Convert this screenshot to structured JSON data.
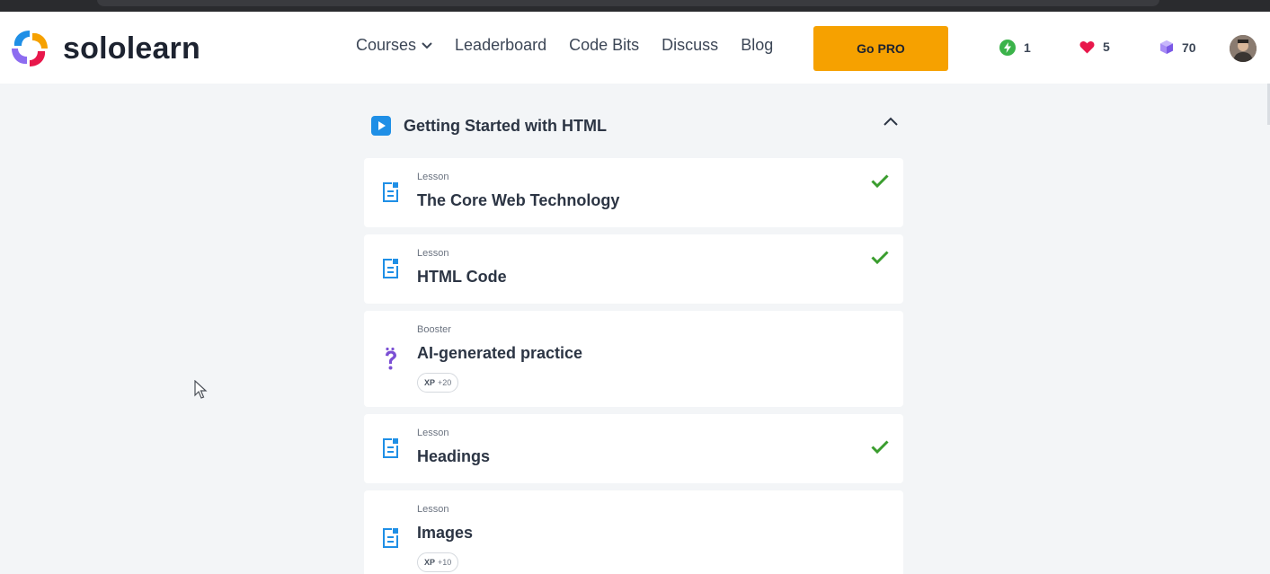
{
  "brand": {
    "name": "sololearn"
  },
  "nav": {
    "links": [
      {
        "label": "Courses",
        "has_dropdown": true
      },
      {
        "label": "Leaderboard"
      },
      {
        "label": "Code Bits"
      },
      {
        "label": "Discuss"
      },
      {
        "label": "Blog"
      }
    ],
    "go_pro_label": "Go PRO"
  },
  "stats": {
    "streak": {
      "icon": "lightning-icon",
      "value": "1",
      "color": "#3bb34a"
    },
    "hearts": {
      "icon": "heart-icon",
      "value": "5",
      "color": "#e8174b"
    },
    "gems": {
      "icon": "gem-icon",
      "value": "70",
      "color": "#8d6cf0"
    }
  },
  "module": {
    "title": "Getting Started with HTML",
    "expanded": true,
    "items": [
      {
        "kind": "Lesson",
        "title": "The Core Web Technology",
        "completed": true,
        "icon": "lesson-icon"
      },
      {
        "kind": "Lesson",
        "title": "HTML Code",
        "completed": true,
        "icon": "lesson-icon"
      },
      {
        "kind": "Booster",
        "title": "AI-generated practice",
        "completed": false,
        "icon": "question-mark-icon",
        "xp_label": "XP",
        "xp_value": "+20"
      },
      {
        "kind": "Lesson",
        "title": "Headings",
        "completed": true,
        "icon": "lesson-icon"
      },
      {
        "kind": "Lesson",
        "title": "Images",
        "completed": false,
        "icon": "lesson-icon",
        "xp_label": "XP",
        "xp_value": "+10"
      }
    ]
  },
  "colors": {
    "accent": "#f6a100",
    "lesson_icon": "#1f8fe6",
    "check": "#3a9d2e",
    "booster_icon": "#7b4fd4",
    "background": "#f3f5f7"
  }
}
